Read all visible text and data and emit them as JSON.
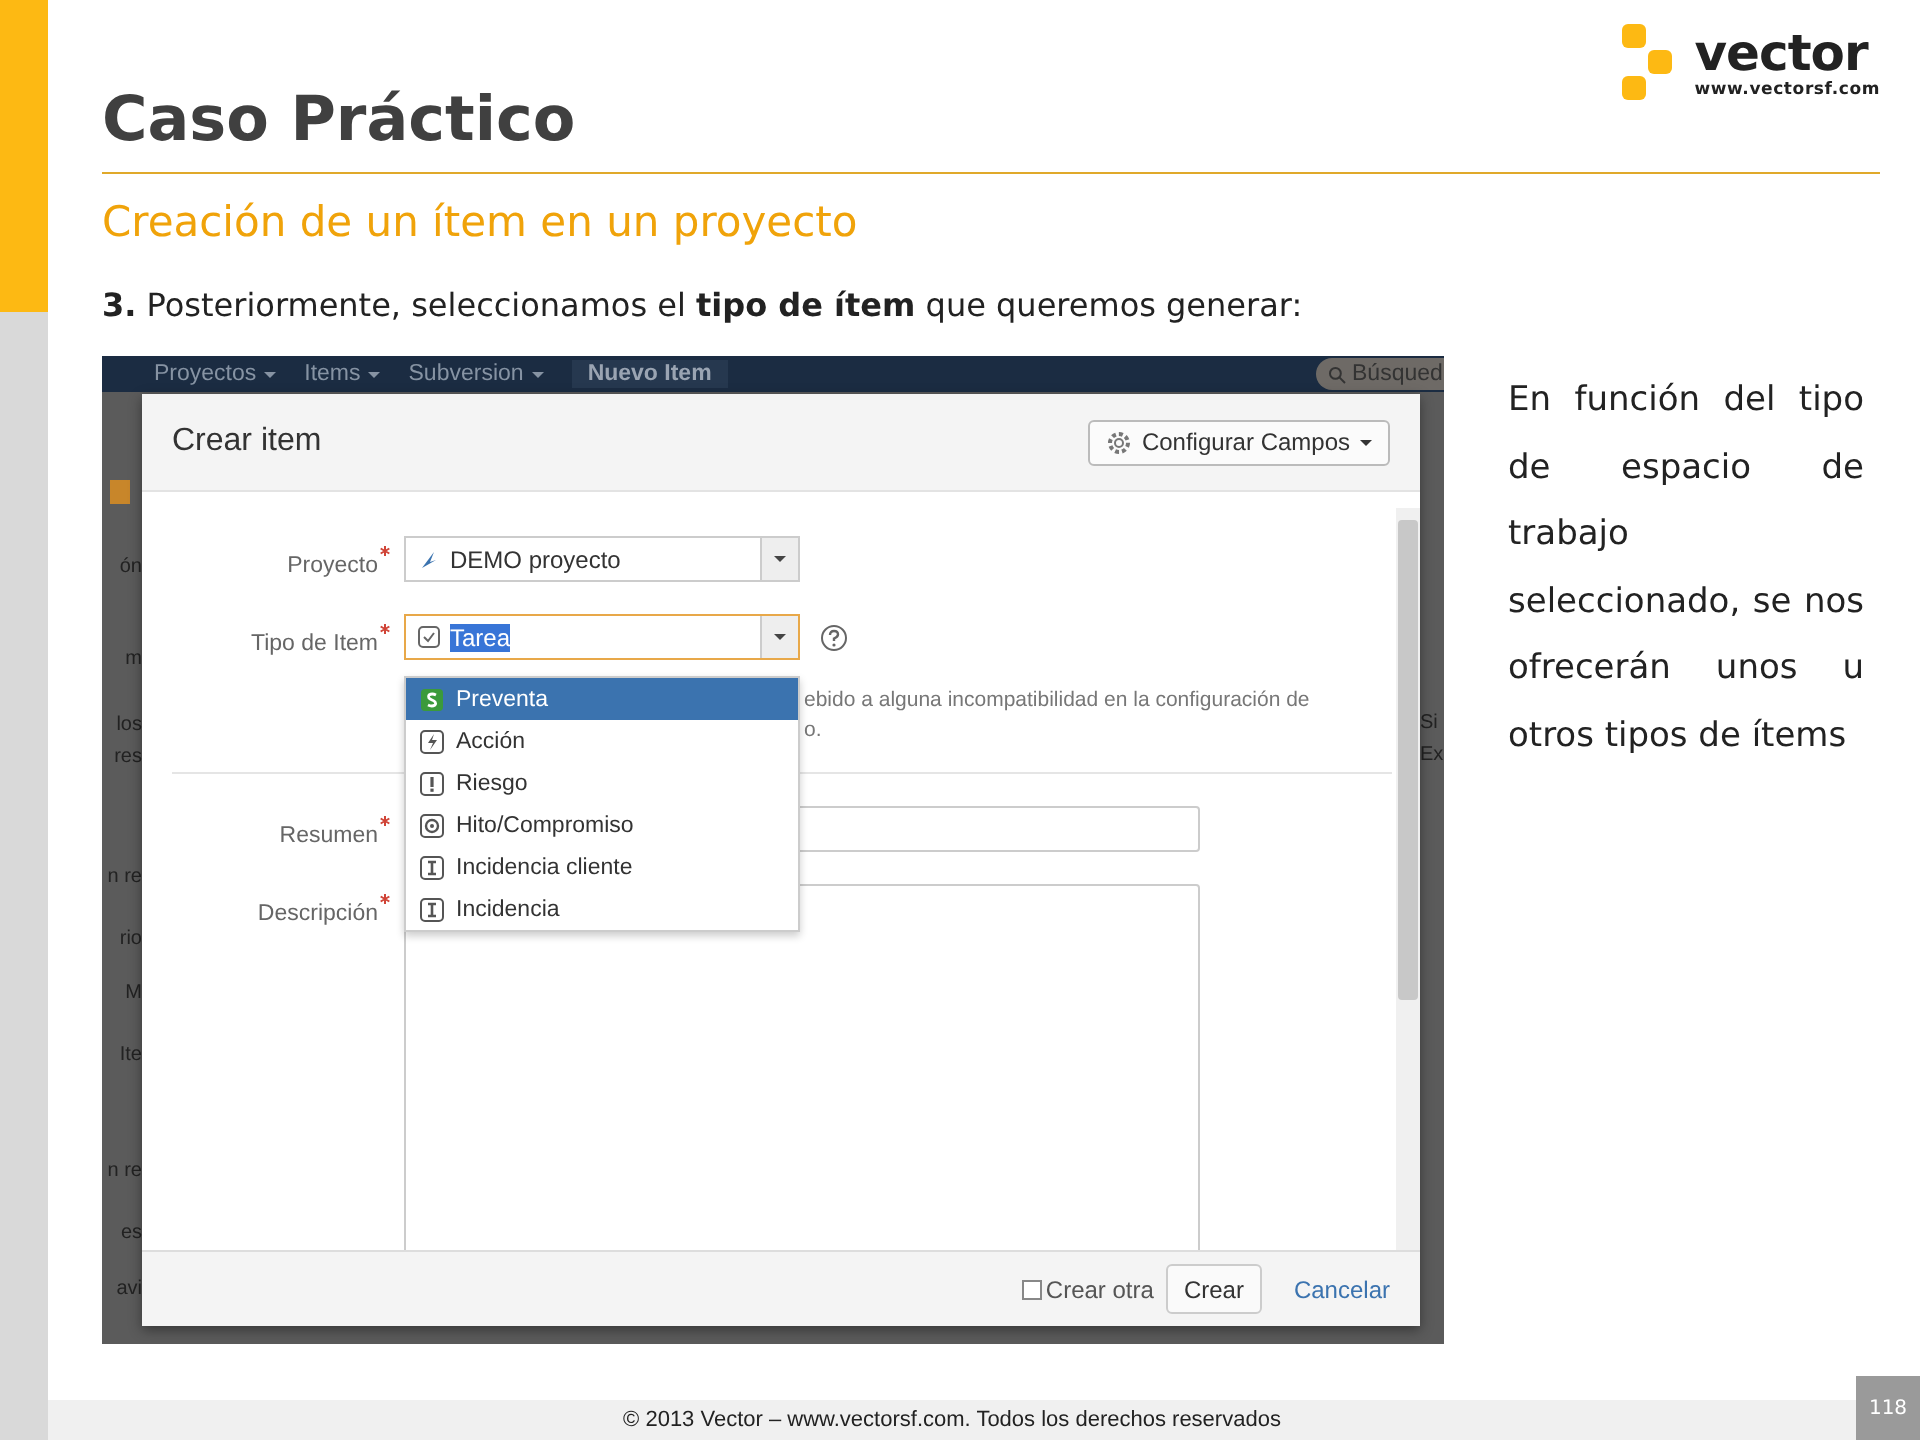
{
  "slide": {
    "title": "Caso Práctico",
    "subtitle": "Creación de un ítem en un proyecto",
    "step": "**3.** Posteriormente, seleccionamos el **tipo de ítem** que queremos generar:",
    "side_text": "En función del tipo de espacio de trabajo seleccionado, se nos ofrecerán unos u otros tipos de ítems",
    "footer": "© 2013 Vector – www.vectorsf.com. Todos los derechos reservados",
    "page_number": "118"
  },
  "logo": {
    "name": "vector",
    "url": "www.vectorsf.com"
  },
  "screenshot": {
    "nav": [
      {
        "label": "Proyectos",
        "kind": "menu"
      },
      {
        "label": "Items",
        "kind": "menu"
      },
      {
        "label": "Subversion",
        "kind": "menu"
      },
      {
        "label": "Nuevo Item",
        "kind": "button"
      }
    ],
    "search": {
      "placeholder": "Búsqued"
    },
    "left_fragments": [
      "ón",
      "m",
      "los",
      "res",
      "n re",
      "rio",
      "M",
      "Ite",
      "n re",
      "es",
      "avi"
    ],
    "right_fragments": [
      "Si",
      "Ex"
    ],
    "dialog": {
      "title": "Crear item",
      "configure_button": "Configurar Campos",
      "fields": [
        {
          "label": "Proyecto",
          "required": true,
          "kind": "select",
          "value": "DEMO proyecto",
          "focused": false
        },
        {
          "label": "Tipo de Item",
          "required": true,
          "kind": "select",
          "value": "Tarea",
          "focused": true
        },
        {
          "label": "Resumen",
          "required": true,
          "kind": "text"
        },
        {
          "label": "Descripción",
          "required": true,
          "kind": "textarea"
        }
      ],
      "help_text": [
        "ebido a alguna incompatibilidad en la configuración de",
        "o."
      ],
      "dropdown": [
        {
          "label": "Preventa",
          "kind": "sale",
          "selected": true
        },
        {
          "label": "Acción",
          "kind": "action",
          "selected": false
        },
        {
          "label": "Riesgo",
          "kind": "risk",
          "selected": false
        },
        {
          "label": "Hito/Compromiso",
          "kind": "milestone",
          "selected": false
        },
        {
          "label": "Incidencia cliente",
          "kind": "incident",
          "selected": false
        },
        {
          "label": "Incidencia",
          "kind": "incident",
          "selected": false
        }
      ],
      "create_another": {
        "label": "Crear otra",
        "checked": false
      },
      "submit": "Crear",
      "cancel": "Cancelar"
    }
  }
}
